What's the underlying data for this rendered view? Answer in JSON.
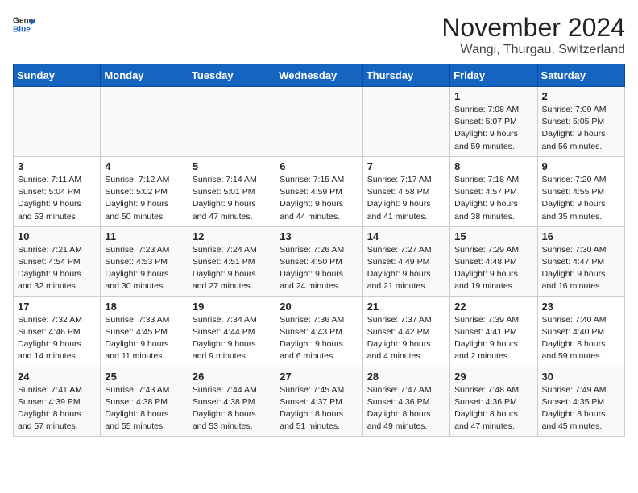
{
  "header": {
    "logo_general": "General",
    "logo_blue": "Blue",
    "month_year": "November 2024",
    "location": "Wangi, Thurgau, Switzerland"
  },
  "weekdays": [
    "Sunday",
    "Monday",
    "Tuesday",
    "Wednesday",
    "Thursday",
    "Friday",
    "Saturday"
  ],
  "weeks": [
    [
      {
        "day": "",
        "info": ""
      },
      {
        "day": "",
        "info": ""
      },
      {
        "day": "",
        "info": ""
      },
      {
        "day": "",
        "info": ""
      },
      {
        "day": "",
        "info": ""
      },
      {
        "day": "1",
        "info": "Sunrise: 7:08 AM\nSunset: 5:07 PM\nDaylight: 9 hours\nand 59 minutes."
      },
      {
        "day": "2",
        "info": "Sunrise: 7:09 AM\nSunset: 5:05 PM\nDaylight: 9 hours\nand 56 minutes."
      }
    ],
    [
      {
        "day": "3",
        "info": "Sunrise: 7:11 AM\nSunset: 5:04 PM\nDaylight: 9 hours\nand 53 minutes."
      },
      {
        "day": "4",
        "info": "Sunrise: 7:12 AM\nSunset: 5:02 PM\nDaylight: 9 hours\nand 50 minutes."
      },
      {
        "day": "5",
        "info": "Sunrise: 7:14 AM\nSunset: 5:01 PM\nDaylight: 9 hours\nand 47 minutes."
      },
      {
        "day": "6",
        "info": "Sunrise: 7:15 AM\nSunset: 4:59 PM\nDaylight: 9 hours\nand 44 minutes."
      },
      {
        "day": "7",
        "info": "Sunrise: 7:17 AM\nSunset: 4:58 PM\nDaylight: 9 hours\nand 41 minutes."
      },
      {
        "day": "8",
        "info": "Sunrise: 7:18 AM\nSunset: 4:57 PM\nDaylight: 9 hours\nand 38 minutes."
      },
      {
        "day": "9",
        "info": "Sunrise: 7:20 AM\nSunset: 4:55 PM\nDaylight: 9 hours\nand 35 minutes."
      }
    ],
    [
      {
        "day": "10",
        "info": "Sunrise: 7:21 AM\nSunset: 4:54 PM\nDaylight: 9 hours\nand 32 minutes."
      },
      {
        "day": "11",
        "info": "Sunrise: 7:23 AM\nSunset: 4:53 PM\nDaylight: 9 hours\nand 30 minutes."
      },
      {
        "day": "12",
        "info": "Sunrise: 7:24 AM\nSunset: 4:51 PM\nDaylight: 9 hours\nand 27 minutes."
      },
      {
        "day": "13",
        "info": "Sunrise: 7:26 AM\nSunset: 4:50 PM\nDaylight: 9 hours\nand 24 minutes."
      },
      {
        "day": "14",
        "info": "Sunrise: 7:27 AM\nSunset: 4:49 PM\nDaylight: 9 hours\nand 21 minutes."
      },
      {
        "day": "15",
        "info": "Sunrise: 7:29 AM\nSunset: 4:48 PM\nDaylight: 9 hours\nand 19 minutes."
      },
      {
        "day": "16",
        "info": "Sunrise: 7:30 AM\nSunset: 4:47 PM\nDaylight: 9 hours\nand 16 minutes."
      }
    ],
    [
      {
        "day": "17",
        "info": "Sunrise: 7:32 AM\nSunset: 4:46 PM\nDaylight: 9 hours\nand 14 minutes."
      },
      {
        "day": "18",
        "info": "Sunrise: 7:33 AM\nSunset: 4:45 PM\nDaylight: 9 hours\nand 11 minutes."
      },
      {
        "day": "19",
        "info": "Sunrise: 7:34 AM\nSunset: 4:44 PM\nDaylight: 9 hours\nand 9 minutes."
      },
      {
        "day": "20",
        "info": "Sunrise: 7:36 AM\nSunset: 4:43 PM\nDaylight: 9 hours\nand 6 minutes."
      },
      {
        "day": "21",
        "info": "Sunrise: 7:37 AM\nSunset: 4:42 PM\nDaylight: 9 hours\nand 4 minutes."
      },
      {
        "day": "22",
        "info": "Sunrise: 7:39 AM\nSunset: 4:41 PM\nDaylight: 9 hours\nand 2 minutes."
      },
      {
        "day": "23",
        "info": "Sunrise: 7:40 AM\nSunset: 4:40 PM\nDaylight: 8 hours\nand 59 minutes."
      }
    ],
    [
      {
        "day": "24",
        "info": "Sunrise: 7:41 AM\nSunset: 4:39 PM\nDaylight: 8 hours\nand 57 minutes."
      },
      {
        "day": "25",
        "info": "Sunrise: 7:43 AM\nSunset: 4:38 PM\nDaylight: 8 hours\nand 55 minutes."
      },
      {
        "day": "26",
        "info": "Sunrise: 7:44 AM\nSunset: 4:38 PM\nDaylight: 8 hours\nand 53 minutes."
      },
      {
        "day": "27",
        "info": "Sunrise: 7:45 AM\nSunset: 4:37 PM\nDaylight: 8 hours\nand 51 minutes."
      },
      {
        "day": "28",
        "info": "Sunrise: 7:47 AM\nSunset: 4:36 PM\nDaylight: 8 hours\nand 49 minutes."
      },
      {
        "day": "29",
        "info": "Sunrise: 7:48 AM\nSunset: 4:36 PM\nDaylight: 8 hours\nand 47 minutes."
      },
      {
        "day": "30",
        "info": "Sunrise: 7:49 AM\nSunset: 4:35 PM\nDaylight: 8 hours\nand 45 minutes."
      }
    ]
  ]
}
